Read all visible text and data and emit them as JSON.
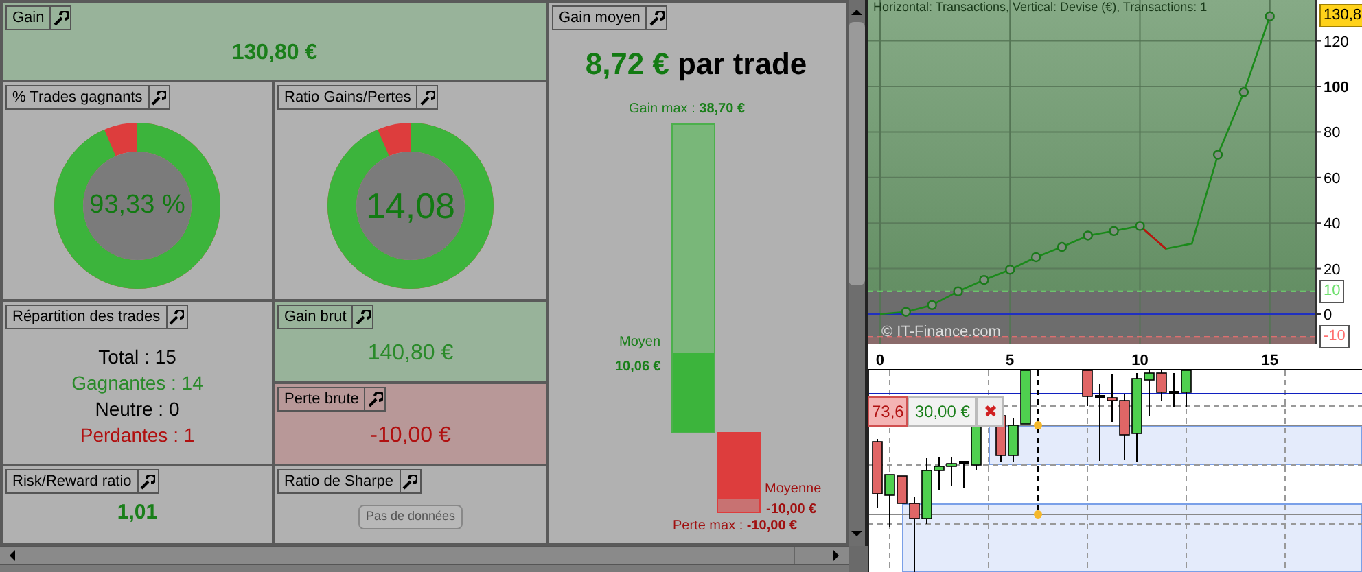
{
  "cards": {
    "gain": {
      "title": "Gain",
      "value": "130,80 €"
    },
    "win_rate": {
      "title": "% Trades gagnants",
      "value": "93,33 %",
      "level": 0.9333
    },
    "gain_loss_ratio": {
      "title": "Ratio Gains/Pertes",
      "value": "14,08",
      "level": 0.9337
    },
    "trade_breakdown": {
      "title": "Répartition des trades",
      "lines": [
        {
          "kind": "neutral",
          "text": "Total : 15"
        },
        {
          "kind": "win",
          "text": "Gagnantes : 14"
        },
        {
          "kind": "neutral",
          "text": "Neutre : 0"
        },
        {
          "kind": "loss",
          "text": "Perdantes : 1"
        }
      ]
    },
    "gross_gain": {
      "title": "Gain brut",
      "value": "140,80 €"
    },
    "gross_loss": {
      "title": "Perte brute",
      "value": "-10,00 €"
    },
    "risk_reward": {
      "title": "Risk/Reward ratio",
      "value": "1,01"
    },
    "sharpe": {
      "title": "Ratio de Sharpe",
      "button": "Pas de données"
    },
    "average_gain": {
      "title": "Gain moyen",
      "value": "8,72 €",
      "suffix": "par trade",
      "max_gain": "Gain max : **38,70 €**",
      "avg_gain_label": "Moyen",
      "avg_gain": "10,06 €",
      "avg_loss_label": "Moyenne",
      "avg_loss": "-10,00 €",
      "max_loss": "Perte max : **-10,00 €**",
      "gain_bar": {
        "level": 0.26
      },
      "loss_bar": {
        "level": 0.85
      }
    }
  },
  "equity_chart": {
    "chart_data": {
      "type": "line",
      "title": "Horizontal: Transactions, Vertical: Devise (€), Transactions: 1",
      "x": [
        0,
        1,
        2,
        3,
        4,
        5,
        6,
        7,
        8,
        9,
        10,
        11,
        12,
        13,
        14,
        15
      ],
      "series": [
        {
          "color": "#1a8a1a",
          "marker": "circle",
          "values": [
            0,
            1,
            4,
            10,
            15,
            19.5,
            25,
            29.5,
            34.5,
            36.5,
            38.7,
            28.7,
            31,
            70,
            97.5,
            130.8
          ]
        }
      ],
      "xlim": [
        -0.475,
        16.75
      ],
      "ylim": [
        -13.25,
        137.95
      ],
      "xticks": [
        0,
        5,
        10,
        15
      ],
      "yticks": [
        0,
        20,
        40,
        60,
        80,
        100,
        120
      ],
      "grid": true,
      "annotations": [
        "130,8"
      ],
      "ref_lines": [
        {
          "axis": "y",
          "value": 10,
          "label": "10",
          "color": "#6ee06e"
        },
        {
          "axis": "y",
          "value": -10,
          "label": "-10",
          "color": "#ff7070"
        },
        {
          "axis": "y",
          "value": 0,
          "color": "#2030c0"
        }
      ],
      "bands": [
        {
          "axis": "y",
          "from": -10,
          "to": 10,
          "color": "#6d6d6d"
        },
        {
          "axis": "y",
          "from": -13.25,
          "to": -10,
          "color": "#8a6b6b"
        }
      ]
    },
    "watermark": "© IT-Finance.com"
  },
  "candle_chart": {
    "price_tag": "73,6",
    "amount_tag": "30,00 €",
    "close": "✖"
  }
}
